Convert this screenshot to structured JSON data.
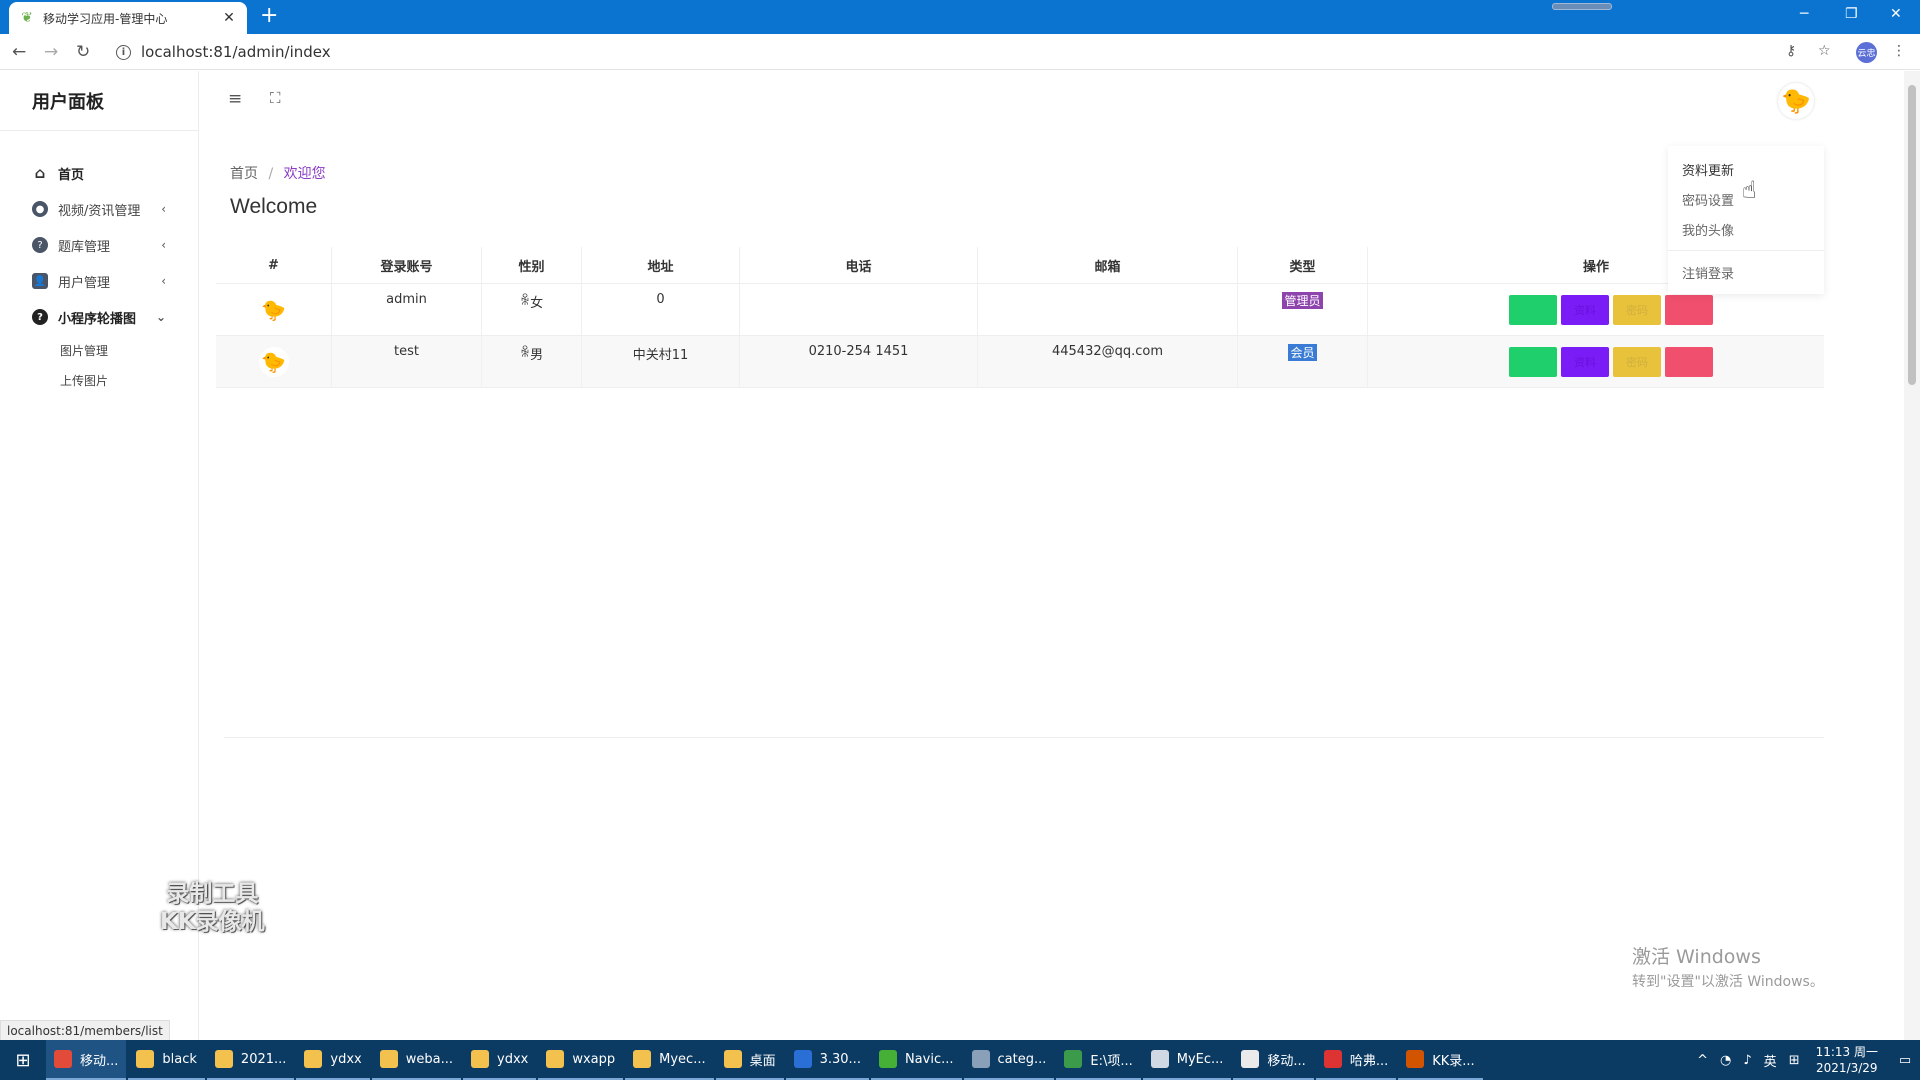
{
  "browser": {
    "tab_title": "移动学习应用-管理中心",
    "url": "localhost:81/admin/index",
    "profile_label": "云忠",
    "status_url": "localhost:81/members/list"
  },
  "sidebar": {
    "brand": "用户面板",
    "items": [
      {
        "label": "首页",
        "icon": "home-icon"
      },
      {
        "label": "视频/资讯管理",
        "icon": "video-icon"
      },
      {
        "label": "题库管理",
        "icon": "question-icon"
      },
      {
        "label": "用户管理",
        "icon": "user-icon"
      },
      {
        "label": "小程序轮播图",
        "icon": "help-icon"
      }
    ],
    "subitems": [
      "图片管理",
      "上传图片"
    ]
  },
  "breadcrumb": {
    "home": "首页",
    "sep": "/",
    "current": "欢迎您"
  },
  "page_title": "Welcome",
  "table": {
    "headers": [
      "#",
      "登录账号",
      "性别",
      "地址",
      "电话",
      "邮箱",
      "类型",
      "操作"
    ],
    "rows": [
      {
        "account": "admin",
        "gender": "女",
        "address": "0",
        "phone": "",
        "email": "",
        "type": "管理员",
        "type_color": "#8e44ad"
      },
      {
        "account": "test",
        "gender": "男",
        "address": "中关村11",
        "phone": "0210-254 1451",
        "email": "445432@qq.com",
        "type": "会员",
        "type_color": "#3a7bd5"
      }
    ],
    "op_labels": [
      "编辑",
      "资料",
      "密码",
      "删除"
    ],
    "op_colors": [
      "#1ecf6b",
      "#7a1cf5",
      "#e7c23a",
      "#f0506e"
    ]
  },
  "user_dropdown": [
    "资料更新",
    "密码设置",
    "我的头像",
    "注销登录"
  ],
  "watermark": {
    "line1": "录制工具",
    "line2": "KK录像机"
  },
  "activation": {
    "line1": "激活 Windows",
    "line2": "转到\"设置\"以激活 Windows。"
  },
  "taskbar": {
    "items": [
      "移动...",
      "black",
      "2021...",
      "ydxx",
      "weba...",
      "ydxx",
      "wxapp",
      "Myec...",
      "桌面",
      "3.30...",
      "Navic...",
      "categ...",
      "E:\\项...",
      "MyEc...",
      "移动...",
      "哈弗...",
      "KK录..."
    ],
    "item_colors": [
      "#e24b3a",
      "#f2c14e",
      "#f2c14e",
      "#f2c14e",
      "#f2c14e",
      "#f2c14e",
      "#f2c14e",
      "#f2c14e",
      "#f2c14e",
      "#2a6fd6",
      "#46b036",
      "#8aa0b8",
      "#3c9b4a",
      "#cfd8e3",
      "#eaeaea",
      "#d33",
      "#d35400"
    ],
    "ime": "英",
    "time": "11:13 周一",
    "date": "2021/3/29"
  }
}
